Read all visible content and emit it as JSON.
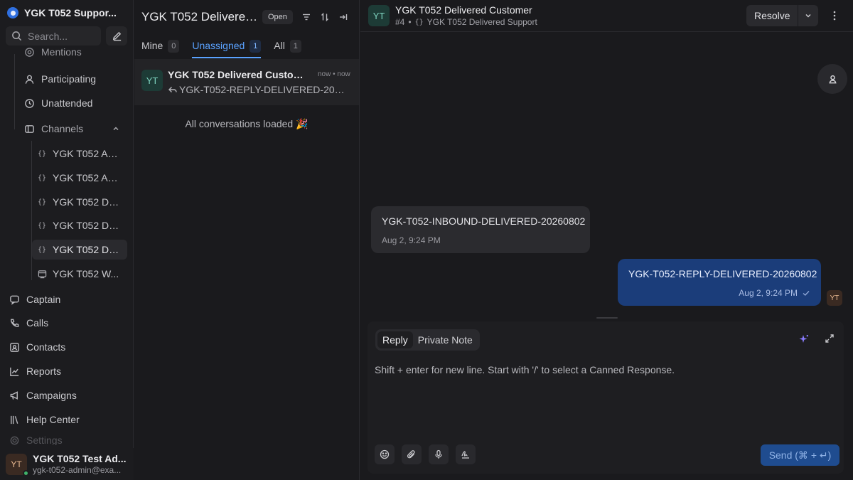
{
  "sidebar": {
    "workspace_name": "YGK T052 Suppor...",
    "search_placeholder": "Search...",
    "items": {
      "mentions": "Mentions",
      "participating": "Participating",
      "unattended": "Unattended",
      "channels": "Channels",
      "captain": "Captain",
      "calls": "Calls",
      "contacts": "Contacts",
      "reports": "Reports",
      "campaigns": "Campaigns",
      "help_center": "Help Center",
      "settings": "Settings"
    },
    "channels": [
      {
        "label": "YGK T052 AP...",
        "icon": "api-icon"
      },
      {
        "label": "YGK T052 AP...",
        "icon": "api-icon"
      },
      {
        "label": "YGK T052 De...",
        "icon": "api-icon"
      },
      {
        "label": "YGK T052 De...",
        "icon": "api-icon"
      },
      {
        "label": "YGK T052 De...",
        "icon": "api-icon",
        "active": true
      },
      {
        "label": "YGK T052 W...",
        "icon": "website-icon"
      }
    ],
    "profile": {
      "initials": "YT",
      "name": "YGK T052 Test Ad...",
      "email": "ygk-t052-admin@exa..."
    }
  },
  "list": {
    "title": "YGK T052 Delivered ...",
    "status": "Open",
    "tabs": [
      {
        "label": "Mine",
        "count": "0"
      },
      {
        "label": "Unassigned",
        "count": "1",
        "active": true
      },
      {
        "label": "All",
        "count": "1"
      }
    ],
    "conversation": {
      "initials": "YT",
      "name": "YGK T052 Delivered Custom...",
      "time": "now • now",
      "preview": "YGK-T052-REPLY-DELIVERED-2026..."
    },
    "loaded_text": "All conversations loaded 🎉"
  },
  "conversation": {
    "initials": "YT",
    "contact_name": "YGK T052 Delivered Customer",
    "conversation_id": "#4",
    "inbox_name": "YGK T052 Delivered Support",
    "resolve_label": "Resolve",
    "messages": [
      {
        "direction": "incoming",
        "text": "YGK-T052-INBOUND-DELIVERED-20260802",
        "time": "Aug 2, 9:24 PM"
      },
      {
        "direction": "outgoing",
        "text": "YGK-T052-REPLY-DELIVERED-20260802",
        "time": "Aug 2, 9:24 PM",
        "sender_initials": "YT"
      }
    ]
  },
  "composer": {
    "modes": [
      "Reply",
      "Private Note"
    ],
    "active_mode": "Reply",
    "placeholder": "Shift + enter for new line. Start with '/' to select a Canned Response.",
    "send_label": "Send (⌘ + ↵)"
  },
  "colors": {
    "accent": "#5aa2ff",
    "outgoing_bubble": "#1b3d7a",
    "send_button": "#1f4c8f",
    "online": "#3fb36a"
  }
}
